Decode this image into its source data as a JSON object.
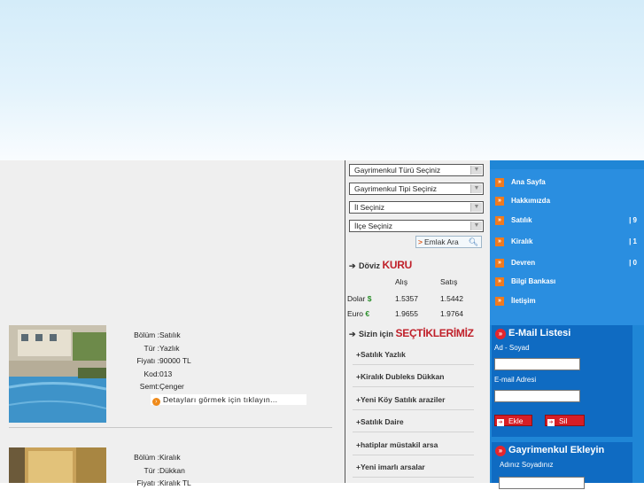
{
  "listings": [
    {
      "fields": [
        {
          "label": "Bölüm :",
          "value": "Satılık"
        },
        {
          "label": "Tür :",
          "value": "Yazlık"
        },
        {
          "label": "Fiyatı :",
          "value": "90000 TL"
        },
        {
          "label": "Kod:",
          "value": "013"
        },
        {
          "label": "Semt:",
          "value": "Çenger"
        }
      ],
      "detail_link": "Detayları görmek için tıklayın..."
    },
    {
      "fields": [
        {
          "label": "Bölüm :",
          "value": "Kiralık"
        },
        {
          "label": "Tür :",
          "value": "Dükkan"
        },
        {
          "label": "Fiyatı :",
          "value": "Kiralık TL"
        }
      ]
    }
  ],
  "search": {
    "selects": [
      "Gayrimenkul Türü Seçiniz",
      "Gayrimenkul Tipi Seçiniz",
      "İl Seçiniz",
      "İlçe Seçiniz"
    ],
    "button_label": "Emlak Ara"
  },
  "doviz": {
    "title_prefix": "Döviz",
    "title_highlight": "KURU",
    "col_buy": "Alış",
    "col_sell": "Satış",
    "rows": [
      {
        "name": "Dolar",
        "symbol": "$",
        "buy": "1.5357",
        "sell": "1.5442"
      },
      {
        "name": "Euro",
        "symbol": "€",
        "buy": "1.9655",
        "sell": "1.9764"
      }
    ]
  },
  "picks": {
    "title_prefix": "Sizin için",
    "title_highlight": "SEÇTİKLERİMİZ",
    "items": [
      "+Satılık Yazlık",
      "+Kiralık Dubleks Dükkan",
      "+Yeni Köy Satılık araziler",
      "+Satılık Daire",
      "+hatiplar müstakil arsa",
      "+Yeni imarlı arsalar"
    ]
  },
  "nav": [
    {
      "label": "Ana Sayfa",
      "count": ""
    },
    {
      "label": "Hakkımızda",
      "count": ""
    },
    {
      "label": "Satılık",
      "count": "| 9"
    },
    {
      "label": "Kiralık",
      "count": "| 1"
    },
    {
      "label": "Devren",
      "count": "| 0"
    },
    {
      "label": "Bilgi Bankası",
      "count": ""
    },
    {
      "label": "İletişim",
      "count": ""
    }
  ],
  "email": {
    "title": "E-Mail Listesi",
    "name_label": "Ad - Soyad",
    "email_label": "E-mail Adresi",
    "add_button": "Ekle",
    "delete_button": "Sil"
  },
  "add_property": {
    "title": "Gayrimenkul Ekleyin",
    "name_label": "Adınız Soyadınız"
  },
  "colors": {
    "nav_bg": "#2a8ee0",
    "accent_red": "#d61e26",
    "bullet_orange": "#f07a1e"
  }
}
